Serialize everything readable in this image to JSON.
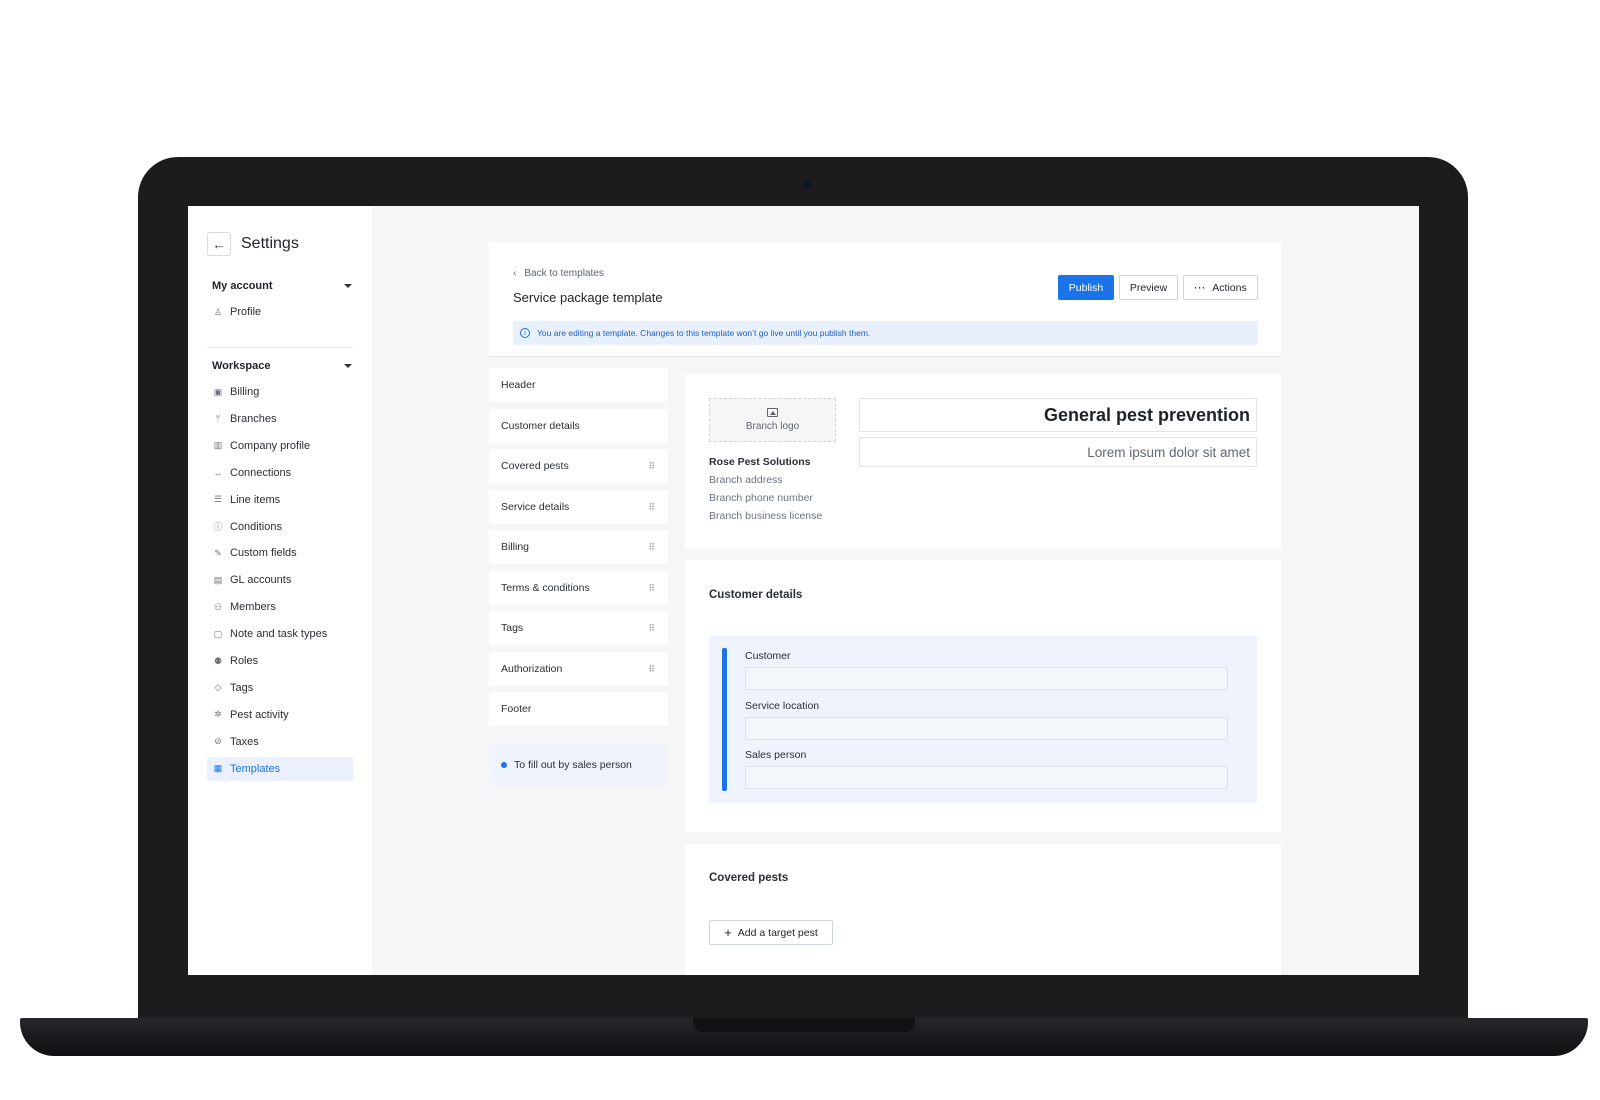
{
  "sidebar": {
    "title": "Settings",
    "sections": {
      "my_account": {
        "label": "My account",
        "items": [
          {
            "label": "Profile",
            "icon": "person-icon",
            "glyph": "♙"
          }
        ]
      },
      "workspace": {
        "label": "Workspace",
        "items": [
          {
            "label": "Billing",
            "icon": "billing-icon",
            "glyph": "▣"
          },
          {
            "label": "Branches",
            "icon": "branches-icon",
            "glyph": "ᛘ"
          },
          {
            "label": "Company profile",
            "icon": "building-icon",
            "glyph": "▥"
          },
          {
            "label": "Connections",
            "icon": "arrows-icon",
            "glyph": "↔"
          },
          {
            "label": "Line items",
            "icon": "list-icon",
            "glyph": "☰"
          },
          {
            "label": "Conditions",
            "icon": "info-circle-icon",
            "glyph": "ⓘ"
          },
          {
            "label": "Custom fields",
            "icon": "edit-icon",
            "glyph": "✎"
          },
          {
            "label": "GL accounts",
            "icon": "ledger-icon",
            "glyph": "▤"
          },
          {
            "label": "Members",
            "icon": "members-icon",
            "glyph": "⚇"
          },
          {
            "label": "Note and task types",
            "icon": "note-icon",
            "glyph": "▢"
          },
          {
            "label": "Roles",
            "icon": "roles-icon",
            "glyph": "⚉"
          },
          {
            "label": "Tags",
            "icon": "tag-icon",
            "glyph": "◇"
          },
          {
            "label": "Pest activity",
            "icon": "bug-icon",
            "glyph": "✲"
          },
          {
            "label": "Taxes",
            "icon": "percent-icon",
            "glyph": "⊘"
          },
          {
            "label": "Templates",
            "icon": "template-icon",
            "glyph": "▦",
            "active": true
          }
        ]
      }
    }
  },
  "top": {
    "back_link": "Back to templates",
    "title": "Service package template",
    "publish": "Publish",
    "preview": "Preview",
    "actions": "Actions",
    "banner": "You are editing a template. Changes to this template won’t go live until you publish them."
  },
  "sections_list": [
    {
      "label": "Header",
      "draggable": false
    },
    {
      "label": "Customer details",
      "draggable": false
    },
    {
      "label": "Covered pests",
      "draggable": true
    },
    {
      "label": "Service details",
      "draggable": true
    },
    {
      "label": "Billing",
      "draggable": true
    },
    {
      "label": "Terms & conditions",
      "draggable": true
    },
    {
      "label": "Tags",
      "draggable": true
    },
    {
      "label": "Authorization",
      "draggable": true
    },
    {
      "label": "Footer",
      "draggable": false
    }
  ],
  "legend": "To fill out by sales person",
  "header_card": {
    "logo_label": "Branch logo",
    "branch_name": "Rose Pest Solutions",
    "branch_address": "Branch address",
    "branch_phone": "Branch phone number",
    "branch_license": "Branch business license",
    "template_title": "General pest prevention",
    "template_subtitle": "Lorem ipsum dolor sit amet"
  },
  "customer_card": {
    "heading": "Customer details",
    "fields": [
      "Customer",
      "Service location",
      "Sales person"
    ]
  },
  "pests_card": {
    "heading": "Covered pests",
    "add_button": "Add a target pest"
  },
  "colors": {
    "accent": "#1a73e8",
    "highlight_bg": "#eef3fc"
  }
}
